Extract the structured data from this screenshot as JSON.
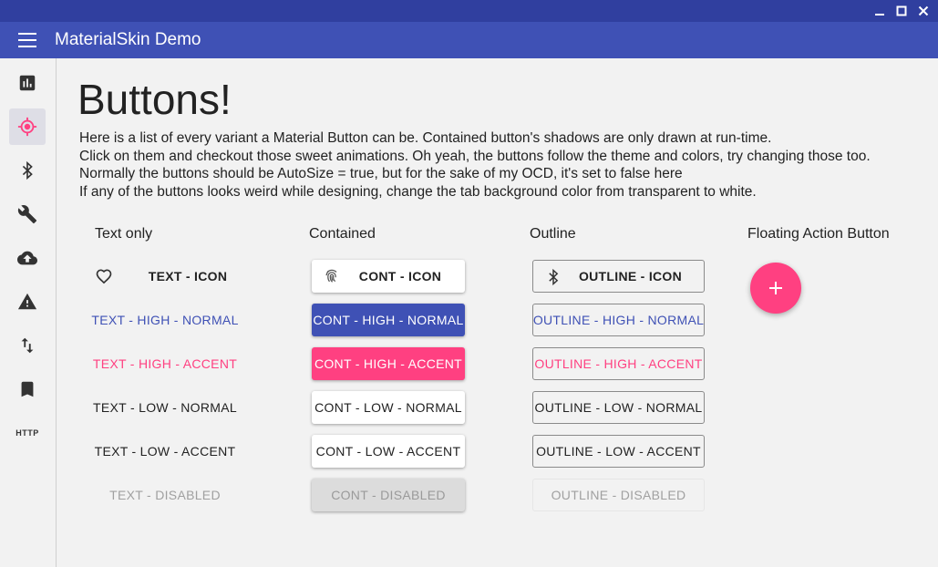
{
  "window": {
    "controls": [
      {
        "name": "minimize",
        "icon": "minimize-icon"
      },
      {
        "name": "maximize",
        "icon": "maximize-icon"
      },
      {
        "name": "close",
        "icon": "close-icon"
      }
    ]
  },
  "appbar": {
    "title": "MaterialSkin Demo",
    "menu_icon": "hamburger-menu-icon"
  },
  "sidebar": {
    "items": [
      {
        "id": "chart",
        "icon": "bar-chart-icon",
        "active": false
      },
      {
        "id": "target",
        "icon": "gps-target-icon",
        "active": true
      },
      {
        "id": "bluetooth",
        "icon": "bluetooth-icon",
        "active": false
      },
      {
        "id": "tools",
        "icon": "wrench-icon",
        "active": false
      },
      {
        "id": "upload",
        "icon": "cloud-upload-icon",
        "active": false
      },
      {
        "id": "warning",
        "icon": "warning-icon",
        "active": false
      },
      {
        "id": "swap",
        "icon": "swap-vertical-icon",
        "active": false
      },
      {
        "id": "bookmark",
        "icon": "bookmark-icon",
        "active": false
      },
      {
        "id": "http",
        "label": "HTTP",
        "active": false
      }
    ]
  },
  "page": {
    "title": "Buttons!",
    "description": [
      "Here is a list of every variant a Material Button can be. Contained button's shadows are only drawn at run-time.",
      "Click on them and checkout those sweet animations. Oh yeah, the buttons follow the theme and colors, try changing those too.",
      "Normally the buttons should be AutoSize = true, but for the sake of my OCD, it's set to false here",
      "If any of the buttons looks weird while designing, change the tab background color from transparent to white."
    ]
  },
  "columns": {
    "text_only": {
      "header": "Text only",
      "buttons": [
        {
          "label": "TEXT - ICON",
          "icon": "heart-icon"
        },
        {
          "label": "TEXT - HIGH - NORMAL"
        },
        {
          "label": "TEXT - HIGH - ACCENT"
        },
        {
          "label": "TEXT - LOW - NORMAL"
        },
        {
          "label": "TEXT - LOW - ACCENT"
        },
        {
          "label": "TEXT - DISABLED"
        }
      ]
    },
    "contained": {
      "header": "Contained",
      "buttons": [
        {
          "label": "CONT - ICON",
          "icon": "fingerprint-icon"
        },
        {
          "label": "CONT - HIGH - NORMAL"
        },
        {
          "label": "CONT - HIGH - ACCENT"
        },
        {
          "label": "CONT - LOW - NORMAL"
        },
        {
          "label": "CONT - LOW - ACCENT"
        },
        {
          "label": "CONT - DISABLED"
        }
      ]
    },
    "outline": {
      "header": "Outline",
      "buttons": [
        {
          "label": "OUTLINE - ICON",
          "icon": "bluetooth-icon"
        },
        {
          "label": "OUTLINE - HIGH - NORMAL"
        },
        {
          "label": "OUTLINE - HIGH - ACCENT"
        },
        {
          "label": "OUTLINE - LOW - NORMAL"
        },
        {
          "label": "OUTLINE - LOW - ACCENT"
        },
        {
          "label": "OUTLINE - DISABLED"
        }
      ]
    },
    "fab": {
      "header": "Floating Action Button",
      "icon": "plus-icon"
    }
  },
  "colors": {
    "titlebar": "#303f9f",
    "primary": "#3f51b5",
    "accent": "#ff4081",
    "sidebar_active_icon": "#ff4081"
  }
}
